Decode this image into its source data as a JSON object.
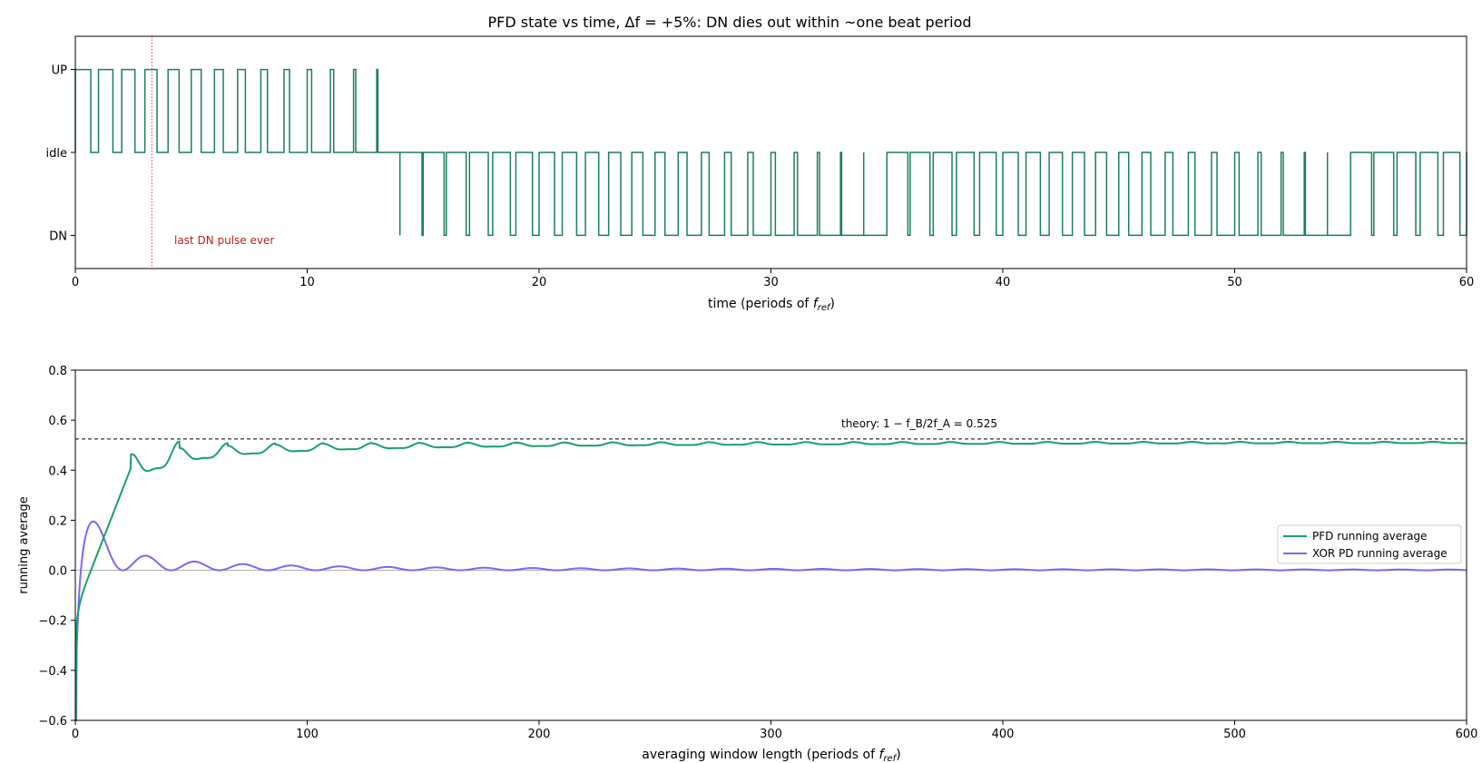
{
  "chart_data": [
    {
      "type": "line",
      "title": "PFD state vs time,  Δf = +5%:  DN dies out within ~one beat period",
      "xlabel_main": "time  (periods of ",
      "xlabel_sub": "f",
      "xlabel_subscript": "ref",
      "xlabel_close": ")",
      "xlim": [
        0,
        60
      ],
      "ylim": [
        -1.4,
        1.4
      ],
      "x_ticks": [
        0,
        10,
        20,
        30,
        40,
        50,
        60
      ],
      "y_ticks": [
        {
          "value": -1,
          "label": "DN"
        },
        {
          "value": 0,
          "label": "idle"
        },
        {
          "value": 1,
          "label": "UP"
        }
      ],
      "freq_ratio": 1.05,
      "last_dn_time": 3.3,
      "annotation": "last DN pulse ever",
      "colors": {
        "state": "#1a7f5a",
        "marker": "#d04040",
        "annotation": "#b22222"
      },
      "grid": false
    },
    {
      "type": "line",
      "xlabel_main": "averaging window length  (periods of ",
      "xlabel_sub": "f",
      "xlabel_subscript": "ref",
      "xlabel_close": ")",
      "ylabel": "running average",
      "xlim": [
        0,
        600
      ],
      "ylim": [
        -0.6,
        0.8
      ],
      "x_ticks": [
        0,
        100,
        200,
        300,
        400,
        500,
        600
      ],
      "y_ticks": [
        -0.6,
        -0.4,
        -0.2,
        0.0,
        0.2,
        0.4,
        0.6,
        0.8
      ],
      "y_tick_labels": [
        "−0.6",
        "−0.4",
        "−0.2",
        "0.0",
        "0.2",
        "0.4",
        "0.6",
        "0.8"
      ],
      "theory_value": 0.525,
      "theory_label": "theory: 1 − f_B/2f_A = 0.525",
      "legend_position": "right",
      "series": [
        {
          "name": "PFD running average",
          "color": "#1a9e6e"
        },
        {
          "name": "XOR PD running average",
          "color": "#7b68ee"
        }
      ],
      "grid": false
    }
  ]
}
